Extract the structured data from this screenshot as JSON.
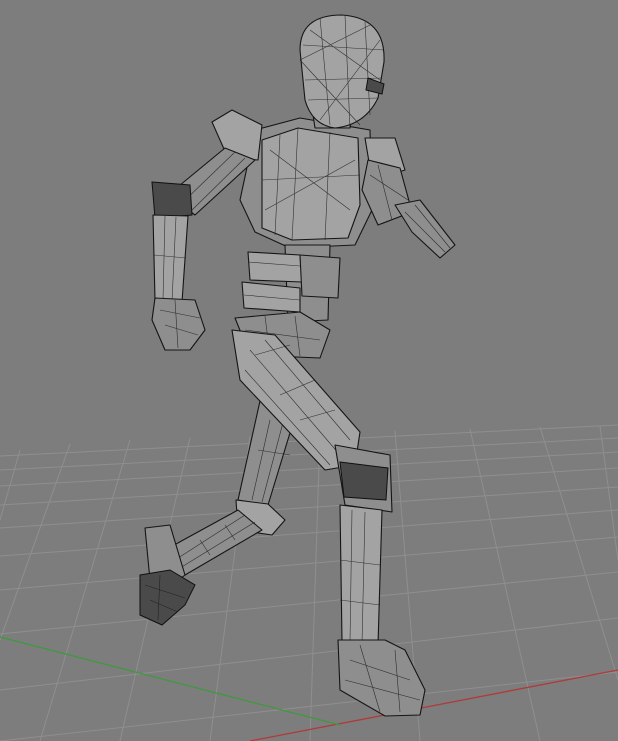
{
  "viewport": {
    "shading_mode": "wireframe-on-shaded",
    "background_color": "#7d7d7d",
    "grid_color": "#8f8f8f",
    "x_axis_color": "#b03a3a",
    "y_axis_color": "#3c9a3c",
    "model_fill_color": "#8e8e8e",
    "wire_color": "#151515"
  },
  "scene": {
    "object": "humanoid-robot",
    "pose": "running"
  }
}
